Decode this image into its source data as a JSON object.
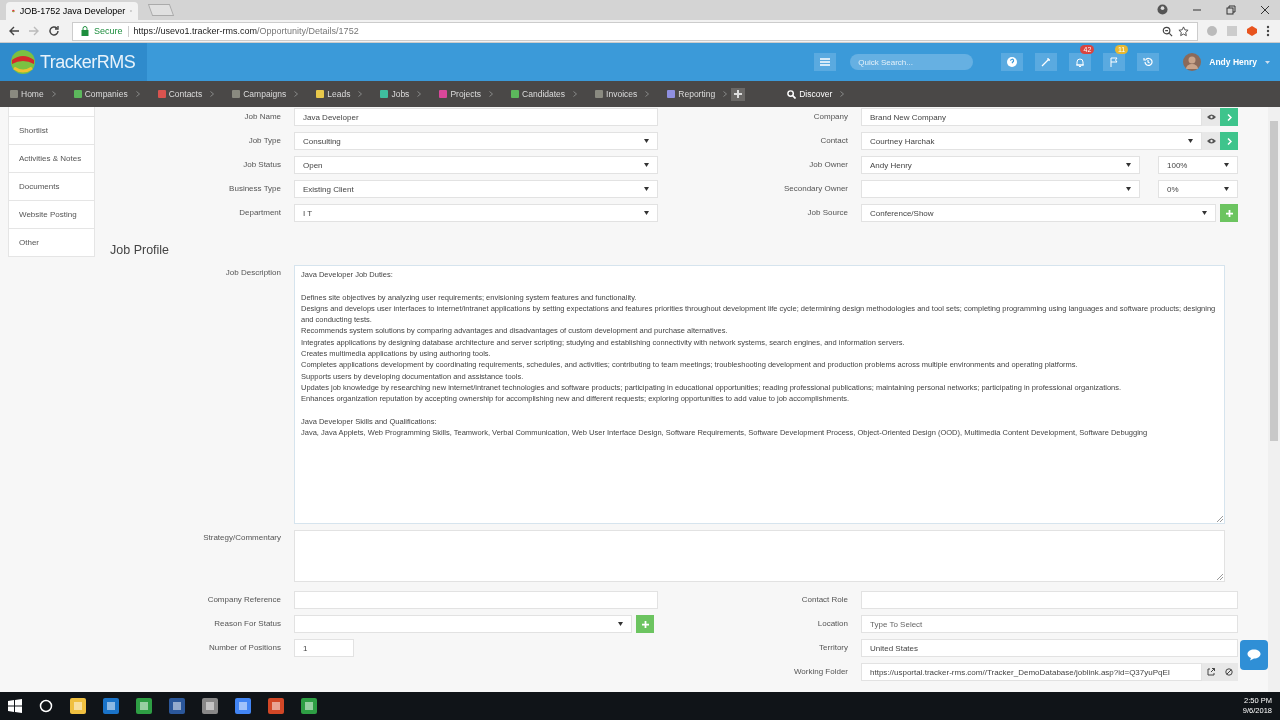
{
  "browser": {
    "tab_title": "JOB-1752 Java Developer",
    "secure_label": "Secure",
    "url_host": "https://usevo1.tracker-rms.com",
    "url_path": "/Opportunity/Details/1752"
  },
  "header": {
    "logo": "TrackerRMS",
    "search_placeholder": "Quick Search...",
    "notifications": "42",
    "flags": "11",
    "user": "Andy Henry"
  },
  "nav": [
    {
      "label": "Home",
      "color": "#8a8a80"
    },
    {
      "label": "Companies",
      "color": "#5cb85c"
    },
    {
      "label": "Contacts",
      "color": "#d9534f"
    },
    {
      "label": "Campaigns",
      "color": "#8a8a80"
    },
    {
      "label": "Leads",
      "color": "#e8c84a"
    },
    {
      "label": "Jobs",
      "color": "#3fbf9f"
    },
    {
      "label": "Projects",
      "color": "#d9479a"
    },
    {
      "label": "Candidates",
      "color": "#5cb85c"
    },
    {
      "label": "Invoices",
      "color": "#8a8a80"
    },
    {
      "label": "Reporting",
      "color": "#8f8fe0"
    }
  ],
  "discover": "Discover",
  "sidebar": [
    "Shortlist",
    "Activities & Notes",
    "Documents",
    "Website Posting",
    "Other"
  ],
  "top_fields": [
    {
      "label": "Job Name",
      "kind": "text",
      "value": "Java Developer"
    },
    {
      "label": "Company",
      "kind": "text",
      "value": "Brand New Company",
      "addons": [
        {
          "kind": "eye"
        },
        {
          "kind": "arrow"
        }
      ]
    },
    {
      "label": "Job Type",
      "kind": "select",
      "value": "Consulting"
    },
    {
      "label": "Contact",
      "kind": "select",
      "value": "Courtney Harchak",
      "addons": [
        {
          "kind": "eye"
        },
        {
          "kind": "arrow"
        }
      ]
    },
    {
      "label": "Job Status",
      "kind": "select",
      "value": "Open"
    },
    {
      "label": "Job Owner",
      "kind": "select",
      "value": "Andy Henry",
      "share": "100%"
    },
    {
      "label": "Business Type",
      "kind": "select",
      "value": "Existing Client"
    },
    {
      "label": "Secondary Owner",
      "kind": "select",
      "share": "0%"
    },
    {
      "label": "Department",
      "kind": "select",
      "value": "I T"
    },
    {
      "label": "Job Source",
      "kind": "select",
      "value": "Conference/Show",
      "addons": [
        {
          "kind": "plus"
        }
      ]
    }
  ],
  "section_title": "Job Profile",
  "description": {
    "label": "Job Description",
    "paragraphs": [
      [
        "Java Developer Job Duties:"
      ],
      [
        "Defines site objectives by analyzing user requirements; envisioning system features and functionality.",
        "Designs and develops user interfaces to internet/intranet applications by setting expectations and features priorities throughout development life cycle; determining design methodologies and tool sets; completing programming using languages and software products; designing and conducting tests.",
        "Recommends system solutions by comparing advantages and disadvantages of custom development and purchase alternatives.",
        "Integrates applications by designing database architecture and server scripting; studying and establishing connectivity with network systems, search engines, and information servers.",
        "Creates multimedia applications by using authoring tools.",
        "Completes applications development by coordinating requirements, schedules, and activities; contributing to team meetings; troubleshooting development and production problems across multiple environments and operating platforms.",
        "Supports users by developing documentation and assistance tools.",
        "Updates job knowledge by researching new internet/intranet technologies and software products; participating in educational opportunities; reading professional publications; maintaining personal networks; participating in professional organizations.",
        "Enhances organization reputation by accepting ownership for accomplishing new and different requests; exploring opportunities to add value to job accomplishments."
      ],
      [
        "Java Developer Skills and Qualifications:",
        "Java, Java Applets, Web Programming Skills, Teamwork, Verbal Communication, Web User Interface Design, Software Requirements, Software Development Process, Object-Oriented Design (OOD), Multimedia Content Development, Software Debugging"
      ]
    ]
  },
  "strategy": {
    "label": "Strategy/Commentary"
  },
  "bottom_fields": [
    {
      "label": "Company Reference",
      "kind": "text"
    },
    {
      "label": "Contact Role",
      "kind": "text"
    },
    {
      "label": "Reason For Status",
      "kind": "select",
      "addons": [
        {
          "kind": "plus"
        }
      ],
      "short": true
    },
    {
      "label": "Location",
      "kind": "text",
      "placeholder": "Type To Select"
    },
    {
      "label": "Number of Positions",
      "kind": "text",
      "value": "1",
      "tiny": true
    },
    {
      "label": "Territory",
      "kind": "text",
      "value": "United States"
    },
    {
      "kind": "empty"
    },
    {
      "label": "Working Folder",
      "kind": "text",
      "value": "https://usportal.tracker-rms.com//Tracker_DemoDatabase/joblink.asp?id=Q37yuPqEI",
      "addons": [
        {
          "kind": "open"
        },
        {
          "kind": "clear"
        }
      ]
    }
  ],
  "taskbar": {
    "time": "2:50 PM",
    "date": "9/6/2018"
  }
}
